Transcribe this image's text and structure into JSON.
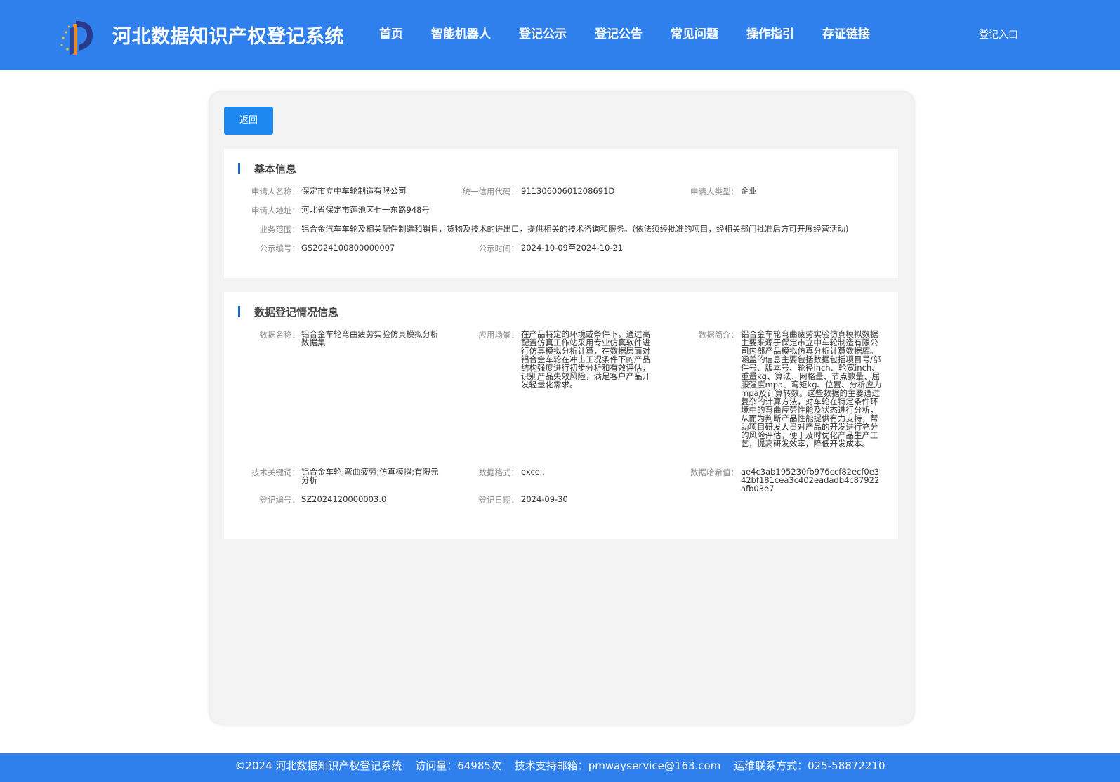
{
  "header": {
    "site_title": "河北数据知识产权登记系统",
    "nav": [
      "首页",
      "智能机器人",
      "登记公示",
      "登记公告",
      "常见问题",
      "操作指引",
      "存证链接"
    ],
    "login": "登记入口"
  },
  "back_button": "返回",
  "basic_info": {
    "title": "基本信息",
    "applicant_name_label": "申请人名称：",
    "applicant_name": "保定市立中车轮制造有限公司",
    "credit_code_label": "统一信用代码：",
    "credit_code": "91130600601208691D",
    "applicant_type_label": "申请人类型：",
    "applicant_type": "企业",
    "address_label": "申请人地址：",
    "address": "河北省保定市莲池区七一东路948号",
    "scope_label": "业务范围：",
    "scope": "铝合金汽车车轮及相关配件制造和销售，货物及技术的进出口，提供相关的技术咨询和服务。(依法须经批准的项目，经相关部门批准后方可开展经营活动)",
    "notice_no_label": "公示编号：",
    "notice_no": "GS2024100800000007",
    "notice_time_label": "公示时间：",
    "notice_time": "2024-10-09至2024-10-21"
  },
  "data_info": {
    "title": "数据登记情况信息",
    "data_name_label": "数据名称：",
    "data_name": "铝合金车轮弯曲疲劳实验仿真模拟分析数据集",
    "scenario_label": "应用场景：",
    "scenario": "在产品特定的环境或条件下，通过高配置仿真工作站采用专业仿真软件进行仿真模拟分析计算，在数据层面对铝合金车轮在冲击工况条件下的产品结构强度进行初步分析和有效评估，识别产品失效风险，满足客户产品开发轻量化需求。",
    "intro_label": "数据简介：",
    "intro": "铝合金车轮弯曲疲劳实验仿真模拟数据主要来源于保定市立中车轮制造有限公司内部产品模拟仿真分析计算数据库。涵盖的信息主要包括数据包括项目号/部件号、版本号、轮径inch、轮宽inch、重量kg、算法、网格量、节点数量、屈服强度mpa、弯矩kg、位置、分析应力mpa及计算转数。这些数据的主要通过复杂的计算方法，对车轮在特定条件环境中的弯曲疲劳性能及状态进行分析，从而为判断产品性能提供有力支持，帮助项目研发人员对产品的开发进行充分的风险评估，便于及时优化产品生产工艺，提高研发效率，降低开发成本。",
    "keywords_label": "技术关键词：",
    "keywords": "铝合金车轮;弯曲疲劳;仿真模拟;有限元分析",
    "format_label": "数据格式：",
    "format": "excel.",
    "hash_label": "数据哈希值：",
    "hash": "ae4c3ab195230fb976ccf82ecf0e342bf181cea3c402eadadb4c87922afb03e7",
    "reg_no_label": "登记编号：",
    "reg_no": "SZ2024120000003.0",
    "reg_date_label": "登记日期：",
    "reg_date": "2024-09-30"
  },
  "footer": {
    "copyright": "©2024 河北数据知识产权登记系统",
    "visits": "访问量：64985次",
    "email": "技术支持邮箱：pmwayservice@163.com",
    "phone": "运维联系方式：025-58872210"
  },
  "colors": {
    "primary": "#2f80ed",
    "button": "#1e88f0",
    "accent_bar": "#1769c2"
  }
}
